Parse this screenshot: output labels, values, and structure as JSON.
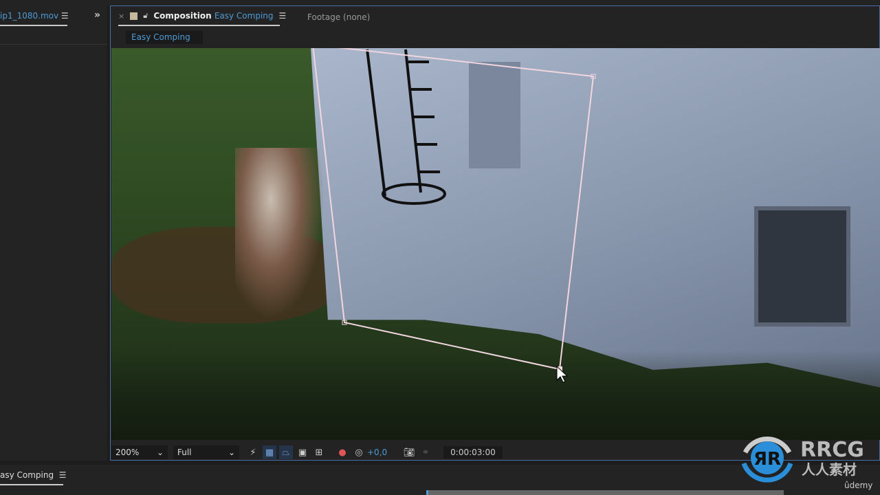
{
  "project_panel": {
    "tab_label": "ip1_1080.mov",
    "expand_icon": "double-chevron-right"
  },
  "composition_panel": {
    "close": "×",
    "title_prefix": "Composition",
    "comp_name": "Easy Comping",
    "footage_tab": "Footage (none)",
    "breadcrumb": "Easy Comping"
  },
  "viewer_controls": {
    "zoom": "200%",
    "resolution": "Full",
    "exposure": "+0,0",
    "timecode": "0:00:03:00",
    "icons": [
      "fast-previews",
      "transparency-grid",
      "mask-path-visibility",
      "region-of-interest",
      "toggle-guides",
      "show-channel",
      "reset-exposure",
      "snapshot",
      "show-snapshot"
    ]
  },
  "timeline": {
    "tab_label": "asy Comping"
  },
  "watermark": {
    "brand": "RRCG",
    "subtitle": "人人素材",
    "udemy": "ûdemy"
  },
  "colors": {
    "accent": "#4e9bd6",
    "panel": "#232323",
    "mask": "#f2d6e0"
  }
}
